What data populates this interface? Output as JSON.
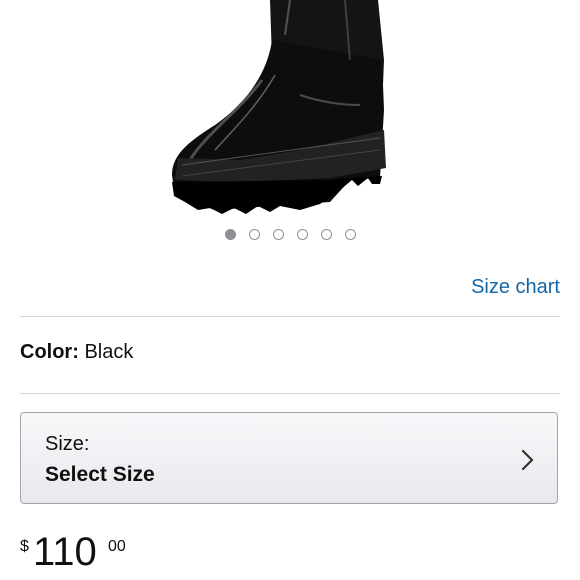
{
  "product_image": {
    "carousel_total": 6,
    "carousel_active_index": 0
  },
  "links": {
    "size_chart": "Size chart"
  },
  "color": {
    "label": "Color:",
    "value": "Black"
  },
  "size": {
    "label": "Size:",
    "value": "Select Size"
  },
  "price": {
    "currency_symbol": "$",
    "whole": "110",
    "fraction": "00"
  },
  "icons": {
    "chevron": "chevron-right-icon"
  }
}
